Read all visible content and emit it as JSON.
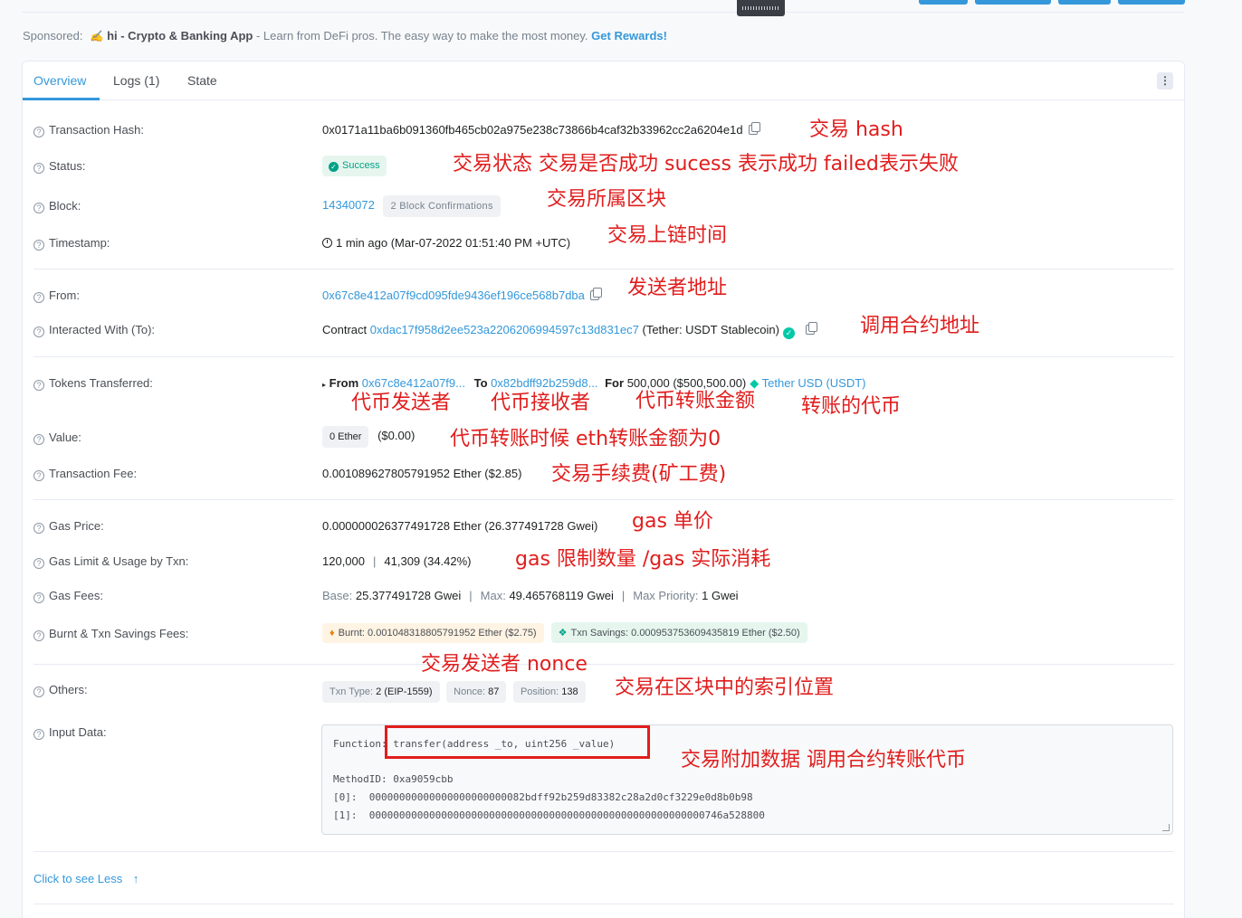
{
  "sponsored": {
    "prefix": "Sponsored:",
    "brand": "hi - Crypto & Banking App",
    "text": " - Learn from DeFi pros. The easy way to make the most money. ",
    "cta": "Get Rewards!"
  },
  "tabs": [
    "Overview",
    "Logs (1)",
    "State"
  ],
  "fields": {
    "tx_hash": {
      "label": "Transaction Hash:",
      "value": "0x0171a11ba6b091360fb465cb02a975e238c73866b4caf32b33962cc2a6204e1d"
    },
    "status": {
      "label": "Status:",
      "value": "Success"
    },
    "block": {
      "label": "Block:",
      "value": "14340072",
      "confirmations": "2 Block Confirmations"
    },
    "timestamp": {
      "label": "Timestamp:",
      "value": "1 min ago (Mar-07-2022 01:51:40 PM +UTC)"
    },
    "from": {
      "label": "From:",
      "value": "0x67c8e412a07f9cd095fde9436ef196ce568b7dba"
    },
    "to": {
      "label": "Interacted With (To):",
      "prefix": "Contract ",
      "address": "0xdac17f958d2ee523a2206206994597c13d831ec7",
      "name": " (Tether: USDT Stablecoin)"
    },
    "tokens": {
      "label": "Tokens Transferred:",
      "from_word": "From",
      "from_addr": "0x67c8e412a07f9...",
      "to_word": "To",
      "to_addr": "0x82bdff92b259d8...",
      "for_word": "For",
      "amount": "500,000",
      "usd": "($500,500.00)",
      "token": "Tether USD (USDT)"
    },
    "value": {
      "label": "Value:",
      "ether": "0 Ether",
      "usd": "($0.00)"
    },
    "tx_fee": {
      "label": "Transaction Fee:",
      "value": "0.001089627805791952 Ether ($2.85)"
    },
    "gas_price": {
      "label": "Gas Price:",
      "value": "0.000000026377491728 Ether (26.377491728 Gwei)"
    },
    "gas_limit": {
      "label": "Gas Limit & Usage by Txn:",
      "limit": "120,000",
      "usage": "41,309 (34.42%)"
    },
    "gas_fees": {
      "label": "Gas Fees:",
      "base_label": "Base:",
      "base": "25.377491728 Gwei",
      "max_label": "Max:",
      "max": "49.465768119 Gwei",
      "prio_label": "Max Priority:",
      "prio": "1 Gwei"
    },
    "burnt": {
      "label": "Burnt & Txn Savings Fees:",
      "burnt_label": "Burnt:",
      "burnt": "0.001048318805791952 Ether ($2.75)",
      "savings_label": "Txn Savings:",
      "savings": "0.000953753609435819 Ether ($2.50)"
    },
    "others": {
      "label": "Others:",
      "txn_type_label": "Txn Type:",
      "txn_type": "2 (EIP-1559)",
      "nonce_label": "Nonce:",
      "nonce": "87",
      "position_label": "Position:",
      "position": "138"
    },
    "input": {
      "label": "Input Data:",
      "function": "Function: transfer(address _to, uint256 _value)",
      "method": "MethodID: 0xa9059cbb",
      "p0": "[0]:  00000000000000000000000082bdff92b259d83382c28a2d0cf3229e0d8b0b98",
      "p1": "[1]:  00000000000000000000000000000000000000000000000000000000746a528800"
    }
  },
  "see_less": "Click to see Less",
  "annotations": {
    "hash": "交易 hash",
    "status": "交易状态 交易是否成功  sucess 表示成功  failed表示失败",
    "block": "交易所属区块",
    "time": "交易上链时间",
    "from": "发送者地址",
    "to": "调用合约地址",
    "tok_from": "代币发送者",
    "tok_to": "代币接收者",
    "tok_amount": "代币转账金额",
    "tok_token": "转账的代币",
    "value": "代币转账时候 eth转账金额为0",
    "fee": "交易手续费(矿工费)",
    "gas_price": "gas 单价",
    "gas_limit": "gas 限制数量 /gas 实际消耗",
    "nonce": "交易发送者 nonce",
    "position": "交易在区块中的索引位置",
    "input": "交易附加数据   调用合约转账代币"
  }
}
